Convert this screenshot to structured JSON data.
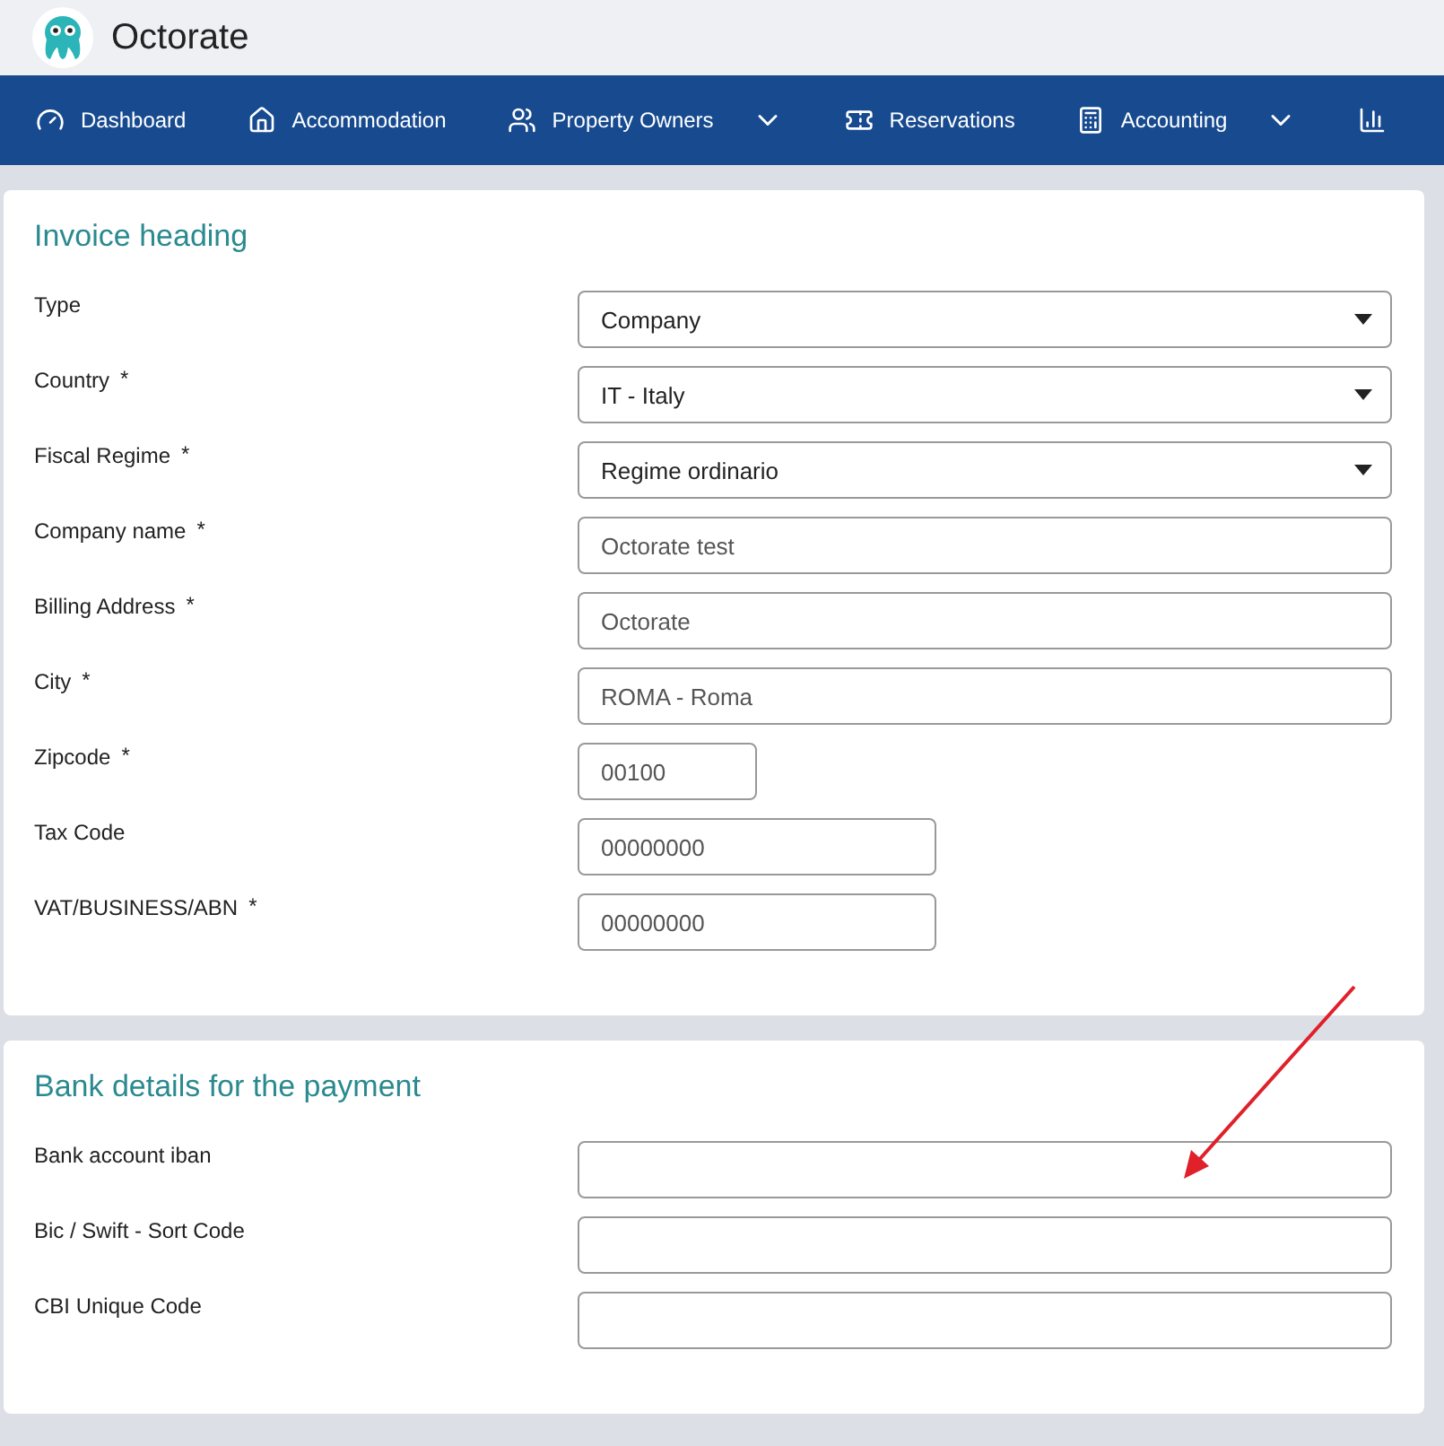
{
  "app": {
    "title": "Octorate"
  },
  "nav": [
    {
      "label": "Dashboard",
      "dropdown": false
    },
    {
      "label": "Accommodation",
      "dropdown": false
    },
    {
      "label": "Property Owners",
      "dropdown": true
    },
    {
      "label": "Reservations",
      "dropdown": false
    },
    {
      "label": "Accounting",
      "dropdown": true
    },
    {
      "dropdown": false
    }
  ],
  "sections": [
    {
      "title": "Invoice heading",
      "fields": [
        {
          "label": "Type",
          "kind": "select",
          "value": "Company"
        },
        {
          "label": "Country",
          "required_mark": "*",
          "kind": "select",
          "value": "IT - Italy"
        },
        {
          "label": "Fiscal Regime",
          "required_mark": "*",
          "kind": "select",
          "value": "Regime ordinario"
        },
        {
          "label": "Company name",
          "required_mark": "*",
          "kind": "input",
          "value": "Octorate test"
        },
        {
          "label": "Billing Address",
          "required_mark": "*",
          "kind": "input",
          "value": "Octorate"
        },
        {
          "label": "City",
          "required_mark": "*",
          "kind": "input",
          "value": "ROMA - Roma"
        },
        {
          "label": "Zipcode",
          "required_mark": "*",
          "kind": "short-input",
          "value": "00100"
        },
        {
          "label": "Tax Code",
          "kind": "medium-input",
          "value": "00000000"
        },
        {
          "label": "VAT/BUSINESS/ABN",
          "required_mark": "*",
          "kind": "medium-input",
          "value": "00000000"
        }
      ]
    },
    {
      "title": "Bank details for the payment",
      "fields": [
        {
          "label": "Bank account iban",
          "kind": "input"
        },
        {
          "label": "Bic / Swift - Sort Code",
          "kind": "input"
        },
        {
          "label": "CBI Unique Code",
          "kind": "input"
        }
      ]
    }
  ]
}
